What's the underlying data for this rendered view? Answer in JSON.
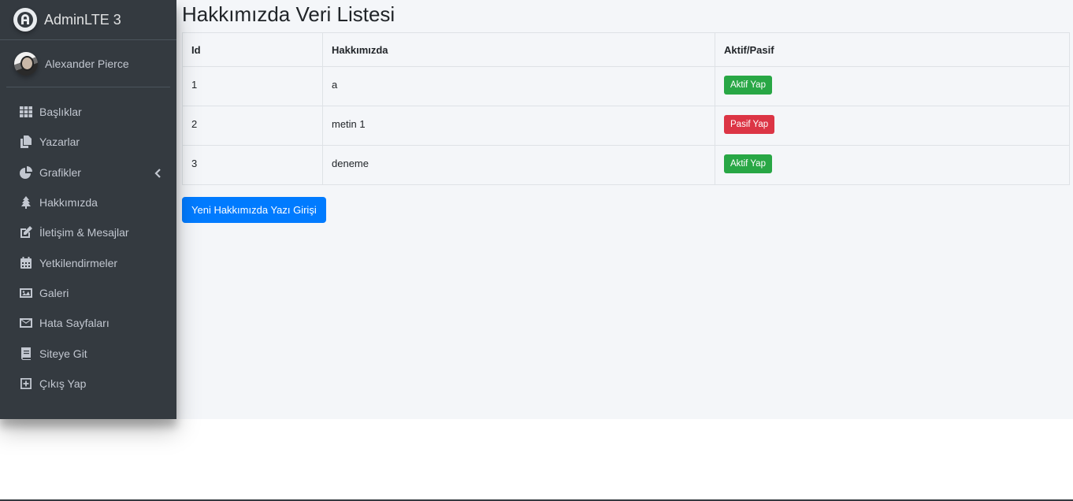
{
  "brand": {
    "name": "AdminLTE 3",
    "logo_icon": "adminlte-logo-icon"
  },
  "user": {
    "name": "Alexander Pierce"
  },
  "sidebar": {
    "items": [
      {
        "label": "Başlıklar",
        "icon": "th-icon"
      },
      {
        "label": "Yazarlar",
        "icon": "copy-icon"
      },
      {
        "label": "Grafikler",
        "icon": "chart-pie-icon"
      },
      {
        "label": "Hakkımızda",
        "icon": "tree-icon"
      },
      {
        "label": "İletişim & Mesajlar",
        "icon": "edit-icon"
      },
      {
        "label": "Yetkilendirmeler",
        "icon": "calendar-icon"
      },
      {
        "label": "Galeri",
        "icon": "image-icon"
      },
      {
        "label": "Hata Sayfaları",
        "icon": "envelope-icon"
      },
      {
        "label": "Siteye Git",
        "icon": "book-icon"
      },
      {
        "label": "Çıkış Yap",
        "icon": "plus-square-icon"
      }
    ]
  },
  "page": {
    "title": "Hakkımızda Veri Listesi",
    "new_button": "Yeni Hakkımızda Yazı Girişi"
  },
  "table": {
    "headers": [
      "Id",
      "Hakkımızda",
      "Aktif/Pasif"
    ],
    "rows": [
      {
        "id": "1",
        "text": "a",
        "action": "Aktif Yap",
        "action_color": "#28a745"
      },
      {
        "id": "2",
        "text": "metin 1",
        "action": "Pasif Yap",
        "action_color": "#dc3545"
      },
      {
        "id": "3",
        "text": "deneme",
        "action": "Aktif Yap",
        "action_color": "#28a745"
      }
    ]
  },
  "colors": {
    "sidebar_bg": "#343a40",
    "content_bg": "#f4f6f9",
    "primary": "#007bff",
    "success": "#28a745",
    "danger": "#dc3545"
  }
}
